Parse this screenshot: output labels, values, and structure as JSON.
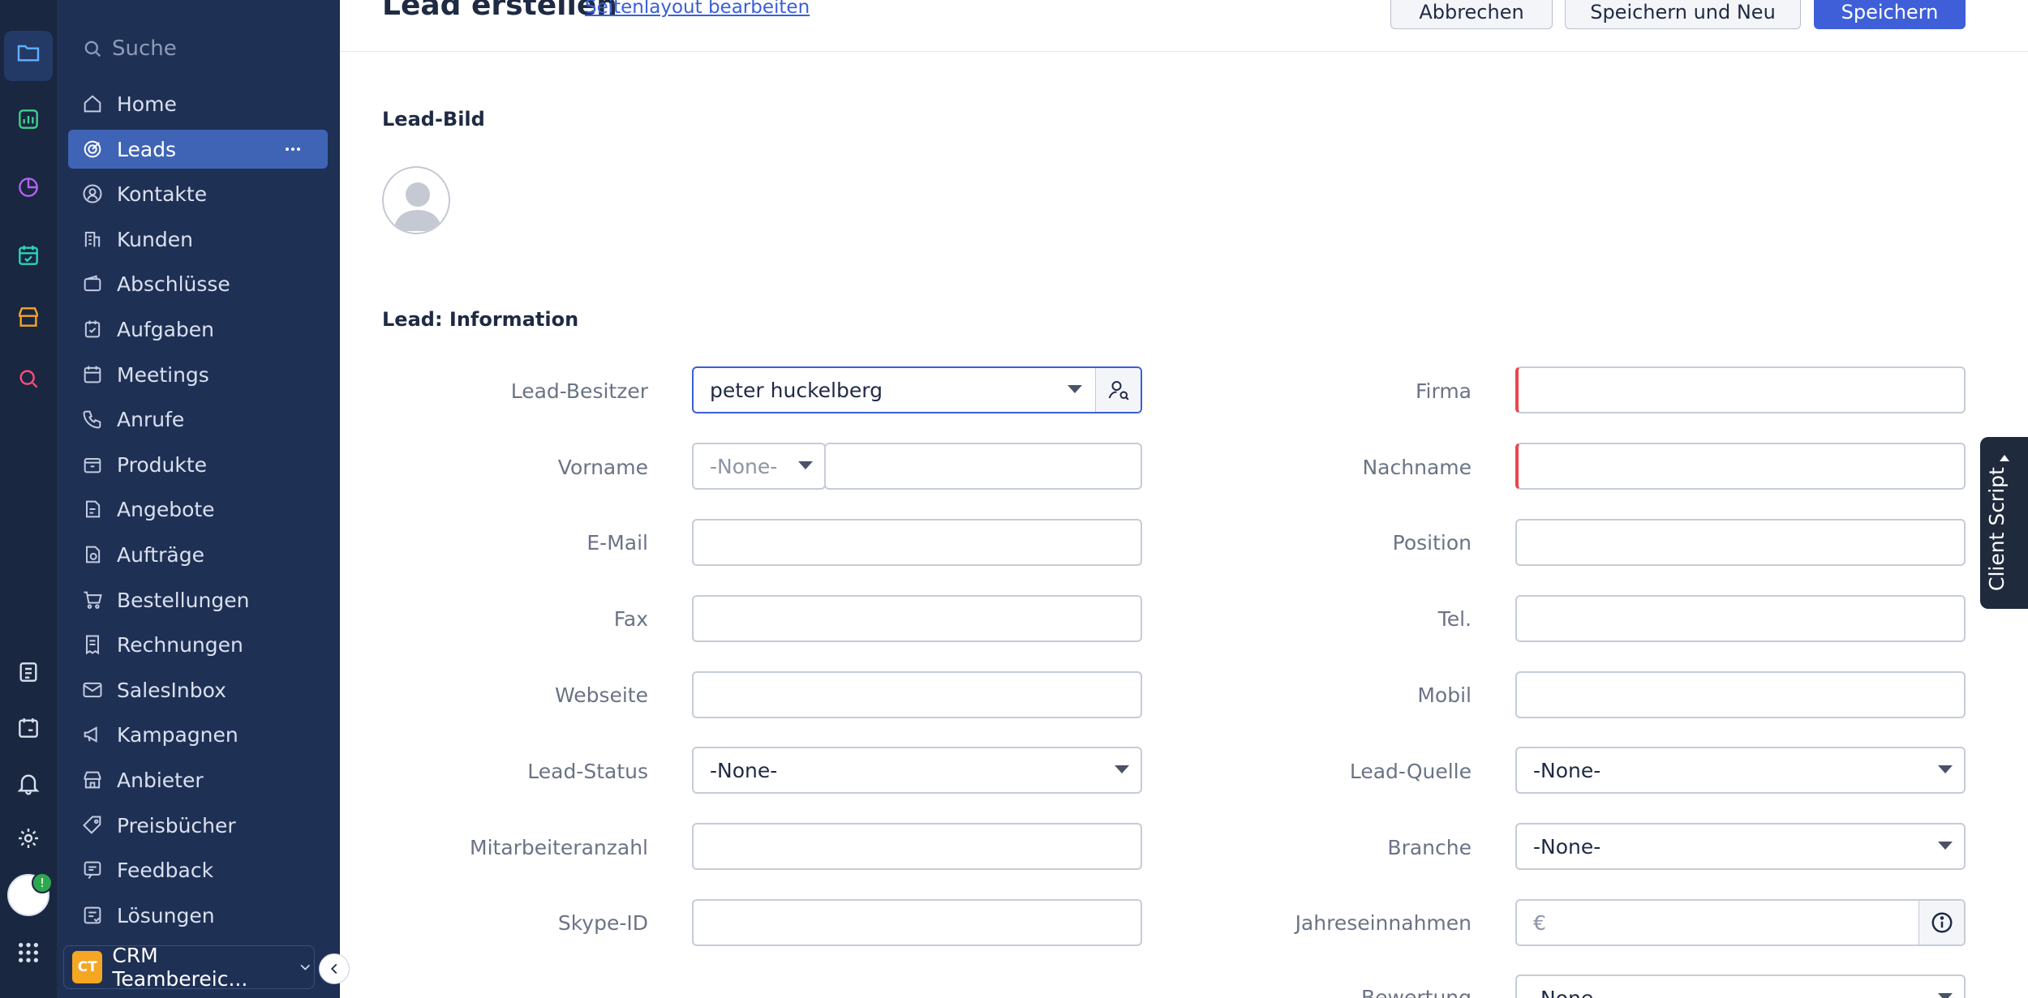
{
  "header": {
    "title": "Lead erstellen",
    "layout_link": "Seitenlayout bearbeiten",
    "cancel_label": "Abbrechen",
    "save_new_label": "Speichern und Neu",
    "save_label": "Speichern"
  },
  "sidebar": {
    "search_placeholder": "Suche",
    "items": [
      {
        "label": "Home",
        "icon": "home-icon"
      },
      {
        "label": "Leads",
        "icon": "target-icon"
      },
      {
        "label": "Kontakte",
        "icon": "contact-icon"
      },
      {
        "label": "Kunden",
        "icon": "building-icon"
      },
      {
        "label": "Abschlüsse",
        "icon": "wallet-icon"
      },
      {
        "label": "Aufgaben",
        "icon": "task-icon"
      },
      {
        "label": "Meetings",
        "icon": "calendar-icon"
      },
      {
        "label": "Anrufe",
        "icon": "phone-icon"
      },
      {
        "label": "Produkte",
        "icon": "box-icon"
      },
      {
        "label": "Angebote",
        "icon": "quote-icon"
      },
      {
        "label": "Aufträge",
        "icon": "order-icon"
      },
      {
        "label": "Bestellungen",
        "icon": "cart-icon"
      },
      {
        "label": "Rechnungen",
        "icon": "invoice-icon"
      },
      {
        "label": "SalesInbox",
        "icon": "mail-icon"
      },
      {
        "label": "Kampagnen",
        "icon": "megaphone-icon"
      },
      {
        "label": "Anbieter",
        "icon": "store-icon"
      },
      {
        "label": "Preisbücher",
        "icon": "tag-icon"
      },
      {
        "label": "Feedback",
        "icon": "feedback-icon"
      },
      {
        "label": "Lösungen",
        "icon": "solution-icon"
      }
    ],
    "active_index": 1,
    "team_initials": "CT",
    "team_label": "CRM Teambereic..."
  },
  "sections": {
    "image": "Lead-Bild",
    "info": "Lead: Information"
  },
  "form": {
    "left": [
      {
        "label": "Lead-Besitzer",
        "value": "peter huckelberg"
      },
      {
        "label": "Vorname",
        "value": "",
        "salutation": "-None-"
      },
      {
        "label": "E-Mail",
        "value": ""
      },
      {
        "label": "Fax",
        "value": ""
      },
      {
        "label": "Webseite",
        "value": ""
      },
      {
        "label": "Lead-Status",
        "value": "-None-"
      },
      {
        "label": "Mitarbeiteranzahl",
        "value": ""
      },
      {
        "label": "Skype-ID",
        "value": ""
      }
    ],
    "right": [
      {
        "label": "Firma",
        "value": ""
      },
      {
        "label": "Nachname",
        "value": ""
      },
      {
        "label": "Position",
        "value": ""
      },
      {
        "label": "Tel.",
        "value": ""
      },
      {
        "label": "Mobil",
        "value": ""
      },
      {
        "label": "Lead-Quelle",
        "value": "-None-"
      },
      {
        "label": "Branche",
        "value": "-None-"
      },
      {
        "label": "Jahreseinnahmen",
        "value": "€"
      },
      {
        "label": "Bewertung",
        "value": "-None-"
      }
    ]
  },
  "client_script_label": "Client Script",
  "colors": {
    "rail": "#1a2740",
    "sidebar": "#1f3055",
    "active": "#3f64b6",
    "primary": "#3f5fd9",
    "required": "#e8474c"
  }
}
